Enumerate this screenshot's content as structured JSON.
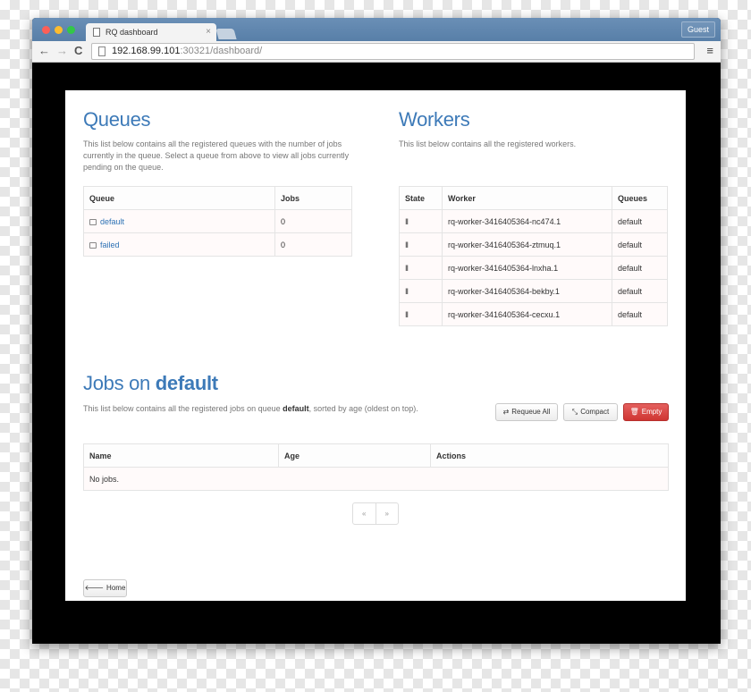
{
  "browser": {
    "tab_title": "RQ dashboard",
    "tab_close": "×",
    "guest_label": "Guest",
    "url_host": "192.168.99.101",
    "url_rest": ":30321/dashboard/",
    "back": "←",
    "forward": "→",
    "reload": "C",
    "menu": "≡"
  },
  "queues": {
    "title": "Queues",
    "description": "This list below contains all the registered queues with the number of jobs currently in the queue. Select a queue from above to view all jobs currently pending on the queue.",
    "headers": [
      "Queue",
      "Jobs"
    ],
    "rows": [
      {
        "name": "default",
        "jobs": "0"
      },
      {
        "name": "failed",
        "jobs": "0"
      }
    ]
  },
  "workers": {
    "title": "Workers",
    "description": "This list below contains all the registered workers.",
    "headers": [
      "State",
      "Worker",
      "Queues"
    ],
    "rows": [
      {
        "state": "II",
        "worker": "rq-worker-3416405364-nc474.1",
        "queues": "default"
      },
      {
        "state": "II",
        "worker": "rq-worker-3416405364-ztmuq.1",
        "queues": "default"
      },
      {
        "state": "II",
        "worker": "rq-worker-3416405364-lnxha.1",
        "queues": "default"
      },
      {
        "state": "II",
        "worker": "rq-worker-3416405364-bekby.1",
        "queues": "default"
      },
      {
        "state": "II",
        "worker": "rq-worker-3416405364-cecxu.1",
        "queues": "default"
      }
    ]
  },
  "jobs": {
    "title_prefix": "Jobs on ",
    "title_queue": "default",
    "desc_prefix": "This list below contains all the registered jobs on queue ",
    "desc_queue": "default",
    "desc_suffix": ", sorted by age (oldest on top).",
    "headers": [
      "Name",
      "Age",
      "Actions"
    ],
    "empty_text": "No jobs.",
    "buttons": {
      "requeue": "Requeue All",
      "compact": "Compact",
      "empty": "Empty"
    },
    "pager": {
      "prev": "«",
      "next": "»"
    }
  },
  "home_button": "Home",
  "colors": {
    "accent": "#3d7ab8",
    "danger": "#d9433f",
    "titlebar": "#5f86ae"
  }
}
